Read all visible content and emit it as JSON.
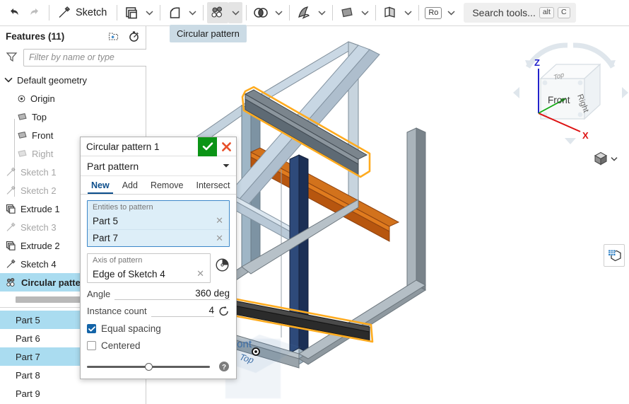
{
  "toolbar": {
    "undo_icon": "undo-arrow-icon",
    "redo_icon": "redo-arrow-icon",
    "sketch_label": "Sketch",
    "sketch_icon": "pencil-sketch-icon",
    "extrude_icon": "extrude-icon",
    "fillet_icon": "fillet-icon",
    "pattern_icon": "circular-pattern-icon",
    "boolean_icon": "boolean-icon",
    "draft_icon": "draft-icon",
    "plane_icon": "plane-icon",
    "transform_icon": "transform-icon",
    "ro_label": "Ro",
    "search_placeholder": "Search tools...",
    "search_key_alt": "alt",
    "search_key_c": "C"
  },
  "tooltip": {
    "text": "Circular pattern"
  },
  "features_panel": {
    "title": "Features (11)",
    "new_folder_icon": "new-folder-icon",
    "history_icon": "stopwatch-icon",
    "filter_icon": "filter-funnel-icon",
    "filter_placeholder": "Filter by name or type",
    "tree": [
      {
        "label": "Default geometry",
        "icon": "chevron-down-icon",
        "type": "folder",
        "level": 0,
        "dim": false,
        "selected": false
      },
      {
        "label": "Origin",
        "icon": "origin-icon",
        "type": "origin",
        "level": 2,
        "dim": false,
        "selected": false
      },
      {
        "label": "Top",
        "icon": "plane-icon",
        "type": "plane",
        "level": 2,
        "dim": false,
        "selected": false
      },
      {
        "label": "Front",
        "icon": "plane-icon",
        "type": "plane",
        "level": 2,
        "dim": false,
        "selected": false
      },
      {
        "label": "Right",
        "icon": "plane-icon",
        "type": "plane",
        "level": 2,
        "dim": true,
        "selected": false
      },
      {
        "label": "Sketch 1",
        "icon": "sketch-icon",
        "type": "sketch",
        "level": 1,
        "dim": true,
        "selected": false
      },
      {
        "label": "Sketch 2",
        "icon": "sketch-icon",
        "type": "sketch",
        "level": 1,
        "dim": true,
        "selected": false
      },
      {
        "label": "Extrude 1",
        "icon": "extrude-icon",
        "type": "extrude",
        "level": 1,
        "dim": false,
        "selected": false
      },
      {
        "label": "Sketch 3",
        "icon": "sketch-icon",
        "type": "sketch",
        "level": 1,
        "dim": true,
        "selected": false
      },
      {
        "label": "Extrude 2",
        "icon": "extrude-icon",
        "type": "extrude",
        "level": 1,
        "dim": false,
        "selected": false
      },
      {
        "label": "Sketch 4",
        "icon": "sketch-icon",
        "type": "sketch",
        "level": 1,
        "dim": false,
        "selected": false
      },
      {
        "label": "Circular patte",
        "icon": "circular-pattern-icon",
        "type": "pattern",
        "level": 1,
        "dim": false,
        "selected": true
      }
    ],
    "parts": [
      {
        "label": "Part 5",
        "selected": true
      },
      {
        "label": "Part 6",
        "selected": false
      },
      {
        "label": "Part 7",
        "selected": true
      },
      {
        "label": "Part 8",
        "selected": false
      },
      {
        "label": "Part 9",
        "selected": false
      }
    ]
  },
  "dialog": {
    "title": "Circular pattern 1",
    "confirm_icon": "checkmark-icon",
    "cancel_icon": "close-x-icon",
    "pattern_type": "Part pattern",
    "pattern_type_caret": "chevron-down-icon",
    "tabs": [
      {
        "label": "New",
        "active": true
      },
      {
        "label": "Add",
        "active": false
      },
      {
        "label": "Remove",
        "active": false
      },
      {
        "label": "Intersect",
        "active": false
      }
    ],
    "entities_caption": "Entities to pattern",
    "entities": [
      {
        "label": "Part 5",
        "remove_icon": "close-x-icon"
      },
      {
        "label": "Part 7",
        "remove_icon": "close-x-icon"
      }
    ],
    "axis_caption": "Axis of pattern",
    "axis_value": "Edge of Sketch 4",
    "axis_remove_icon": "close-x-icon",
    "axis_pick_icon": "axis-selector-icon",
    "angle_label": "Angle",
    "angle_value": "360 deg",
    "instance_label": "Instance count",
    "instance_value": "4",
    "flip_icon": "flip-direction-icon",
    "equal_spacing_label": "Equal spacing",
    "equal_spacing_checked": true,
    "centered_label": "Centered",
    "centered_checked": false,
    "opacity_slider_value": 50,
    "help_icon": "help-question-icon"
  },
  "viewport": {
    "viewcube": {
      "front_face": "Front",
      "right_face": "Right",
      "top_face": "Top",
      "axis_z": "Z",
      "axis_x": "X",
      "rotate_icon": "rotate-arrows-icon"
    },
    "display_style_icon": "shaded-cube-icon",
    "display_style_caret": "chevron-down-icon",
    "panel_toggle_icon": "parts-table-icon",
    "plane_labels": {
      "front": "Front",
      "top": "Top"
    },
    "origin_icon": "origin-point-icon"
  },
  "colors": {
    "accent_blue": "#0d4e8c",
    "selection_blue": "#aadcf0",
    "confirm_green": "#0b9416",
    "cancel_red": "#e8502a",
    "highlight_orange": "#ffab1f",
    "beam_gray": "#8d9398",
    "beam_navy": "#1f3864",
    "beam_copper": "#c55a11",
    "axis_z_blue": "#2222cc",
    "axis_x_red": "#dd1111",
    "axis_y_green": "#11aa11"
  }
}
